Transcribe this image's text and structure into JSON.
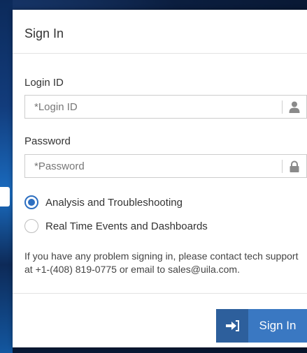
{
  "dialog": {
    "title": "Sign In",
    "login": {
      "label": "Login ID",
      "placeholder": "*Login ID",
      "icon": "user-icon"
    },
    "password": {
      "label": "Password",
      "placeholder": "*Password",
      "icon": "lock-icon"
    },
    "modes": [
      {
        "label": "Analysis and Troubleshooting",
        "checked": true
      },
      {
        "label": "Real Time Events and Dashboards",
        "checked": false
      }
    ],
    "info_text": "If you have any problem signing in, please contact tech support at +1-(408) 819-0775 or email to sales@uila.com.",
    "signin_button": {
      "label": "Sign In",
      "icon": "sign-in-icon"
    }
  },
  "colors": {
    "accent": "#3a78c2",
    "accent_dark": "#2d5f9c",
    "radio_selected": "#2d6fc1"
  }
}
